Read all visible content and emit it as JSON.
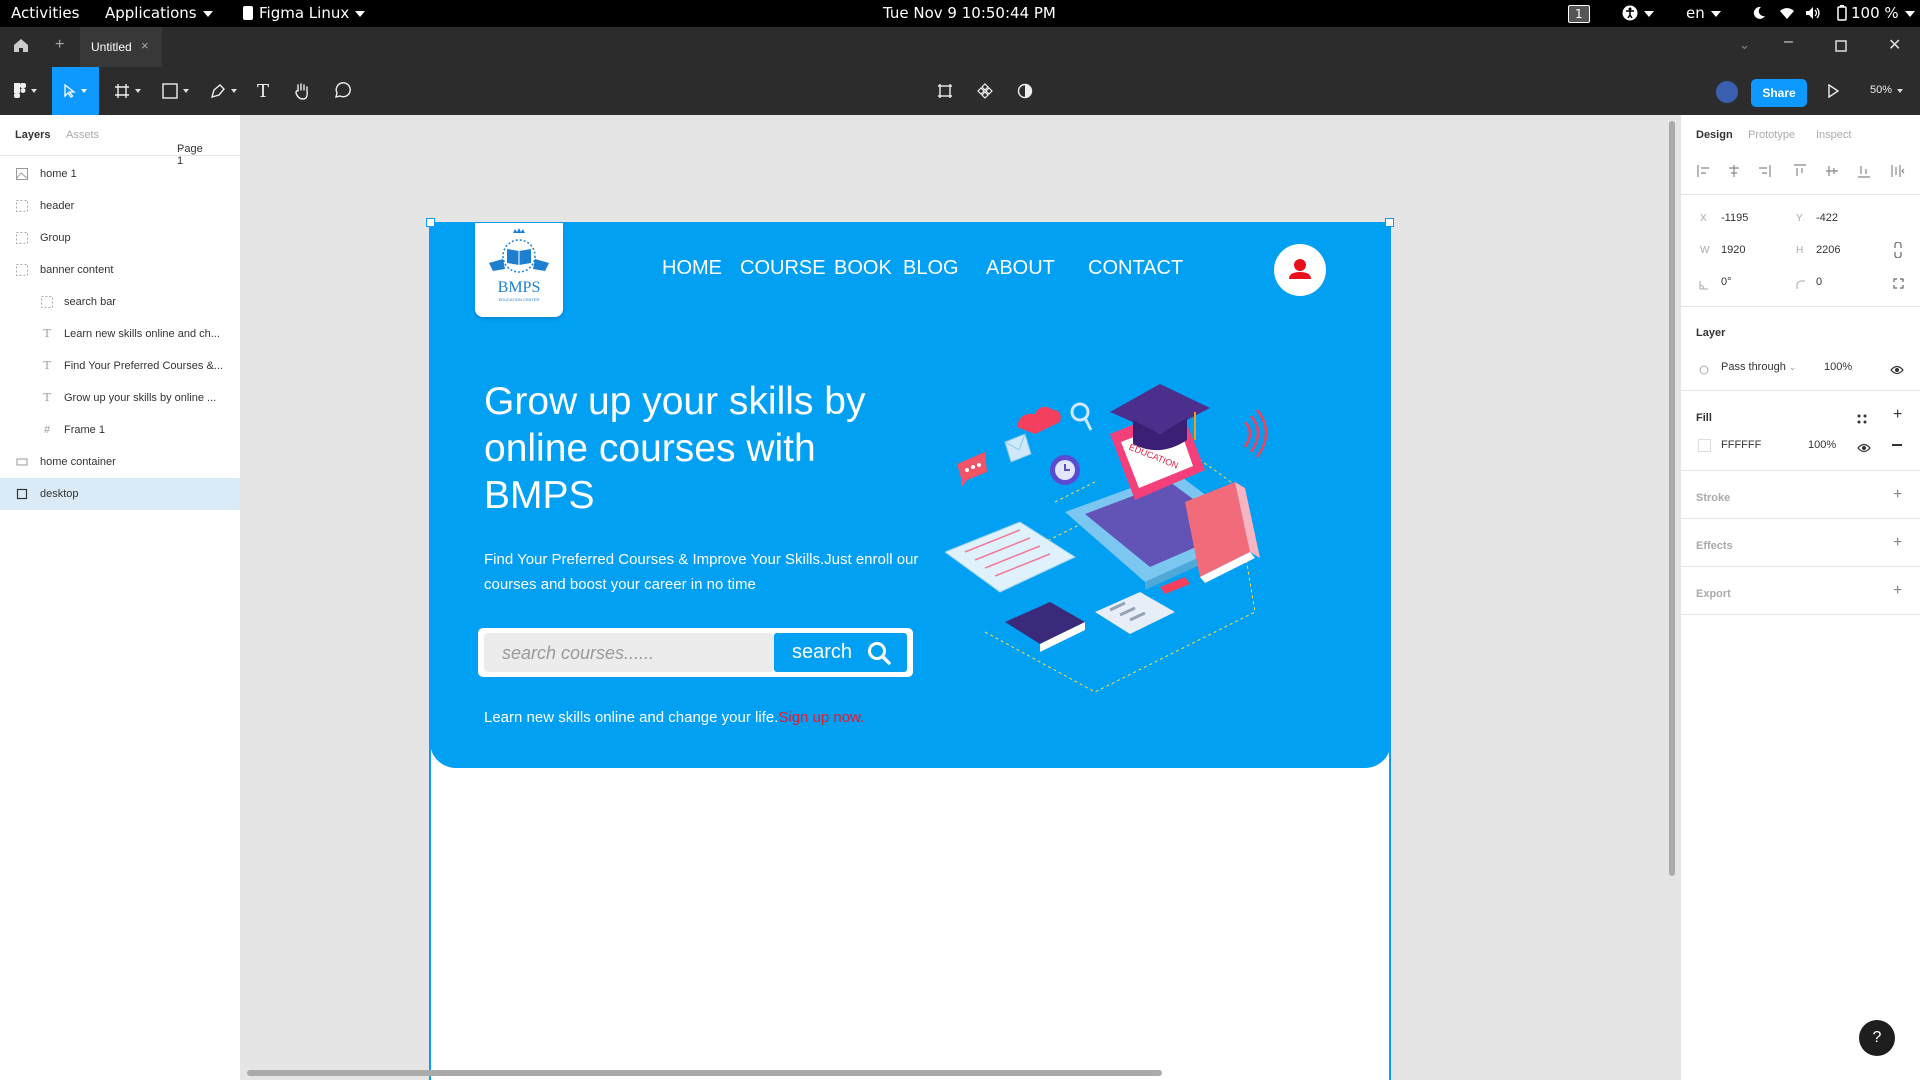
{
  "os_bar": {
    "activities": "Activities",
    "applications": "Applications",
    "app_name": "Figma Linux",
    "datetime": "Tue Nov 9  10:50:44 PM",
    "workspace": "1",
    "language": "en",
    "battery": "100 %"
  },
  "titlebar": {
    "tab_title": "Untitled"
  },
  "toolbar": {
    "share_label": "Share",
    "zoom": "50%"
  },
  "left_panel": {
    "tabs": {
      "layers": "Layers",
      "assets": "Assets",
      "page": "Page 1"
    },
    "layers": [
      {
        "name": "home 1",
        "icon": "image-icon"
      },
      {
        "name": "header",
        "icon": "group-icon"
      },
      {
        "name": "Group",
        "icon": "group-icon"
      },
      {
        "name": "banner content",
        "icon": "group-icon"
      },
      {
        "name": "search bar",
        "icon": "group-icon"
      },
      {
        "name": "Learn new skills online and ch...",
        "icon": "text-icon"
      },
      {
        "name": "Find Your Preferred Courses &...",
        "icon": "text-icon"
      },
      {
        "name": "Grow up your skills by online ...",
        "icon": "text-icon"
      },
      {
        "name": "Frame 1",
        "icon": "frame-icon"
      },
      {
        "name": "home container",
        "icon": "rectangle-icon"
      },
      {
        "name": "desktop",
        "icon": "frame-icon"
      }
    ]
  },
  "design": {
    "nav": [
      "HOME",
      "COURSE",
      "BOOK",
      "BLOG",
      "ABOUT",
      "CONTACT"
    ],
    "logo_text": "BMPS",
    "logo_subtext": "EDUCATION CENTER",
    "hero_title": "Grow up your skills by online courses with BMPS",
    "hero_subtitle": "Find Your Preferred Courses & Improve Your Skills.Just enroll our courses and boost your career in no time",
    "search_placeholder": "search courses......",
    "search_button": "search",
    "learn_text": "Learn new skills online and change your life.",
    "signup_link": "Sign up now.",
    "illustration_label": "EDUCATION",
    "banner_color": "#01a0f3",
    "signup_color": "#e8182e"
  },
  "right_panel": {
    "tabs": {
      "design": "Design",
      "prototype": "Prototype",
      "inspect": "Inspect"
    },
    "x": "-1195",
    "y": "-422",
    "w": "1920",
    "h": "2206",
    "rotation": "0°",
    "radius": "0",
    "layer_label": "Layer",
    "blend_mode": "Pass through",
    "layer_opacity": "100%",
    "fill_label": "Fill",
    "fill_hex": "FFFFFF",
    "fill_opacity": "100%",
    "stroke_label": "Stroke",
    "effects_label": "Effects",
    "export_label": "Export"
  },
  "help_label": "?"
}
